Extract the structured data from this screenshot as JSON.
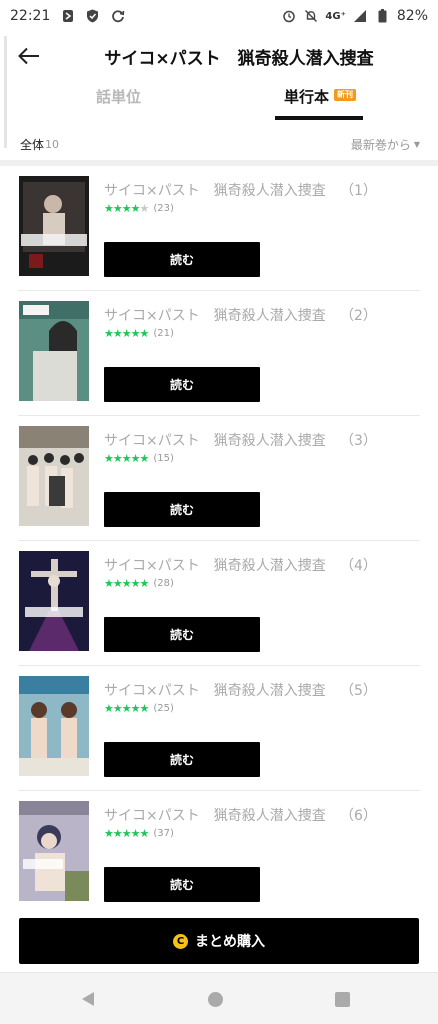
{
  "status_bar": {
    "time": "22:21",
    "network": "4G⁺",
    "battery_pct": "82%",
    "icons": [
      "notification-icon",
      "shield-icon",
      "sync-icon",
      "alarm-icon",
      "mute-icon",
      "signal-icon",
      "battery-icon"
    ]
  },
  "header": {
    "title": "サイコ×パスト　猟奇殺人潜入捜査"
  },
  "tabs": {
    "episode_label": "話単位",
    "volume_label": "単行本",
    "new_badge": "新刊",
    "active": "volume"
  },
  "filter": {
    "all_label": "全体",
    "count": "10",
    "sort_label": "最新巻から"
  },
  "books": [
    {
      "title": "サイコ×パスト　猟奇殺人潜入捜査",
      "volume": "（1）",
      "rating": 4,
      "reviews": "(23)",
      "button": "読む"
    },
    {
      "title": "サイコ×パスト　猟奇殺人潜入捜査",
      "volume": "（2）",
      "rating": 5,
      "reviews": "(21)",
      "button": "読む"
    },
    {
      "title": "サイコ×パスト　猟奇殺人潜入捜査",
      "volume": "（3）",
      "rating": 5,
      "reviews": "(15)",
      "button": "読む"
    },
    {
      "title": "サイコ×パスト　猟奇殺人潜入捜査",
      "volume": "（4）",
      "rating": 5,
      "reviews": "(28)",
      "button": "読む"
    },
    {
      "title": "サイコ×パスト　猟奇殺人潜入捜査",
      "volume": "（5）",
      "rating": 5,
      "reviews": "(25)",
      "button": "読む"
    },
    {
      "title": "サイコ×パスト　猟奇殺人潜入捜査",
      "volume": "（6）",
      "rating": 5,
      "reviews": "(37)",
      "button": "読む"
    }
  ],
  "bulk_purchase": {
    "coin_icon": "C",
    "label": "まとめ購入"
  },
  "colors": {
    "star_on": "#1ec65a",
    "star_off": "#c8c8c8",
    "badge": "#f39a1b",
    "coin": "#f6c115"
  }
}
